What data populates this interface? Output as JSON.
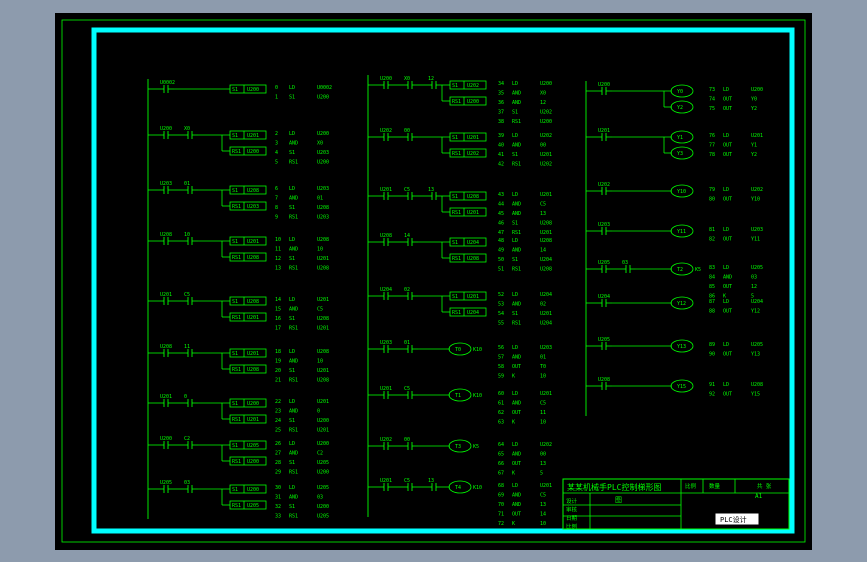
{
  "colors": {
    "line": "#00ff00",
    "frame": "#00ffff",
    "paper": "#000000",
    "background": "#8d9bad"
  },
  "column1": [
    {
      "contacts": [
        {
          "label": "U0002",
          "nc": false
        }
      ],
      "coils": [
        {
          "type": "box",
          "label": "U200",
          "set": "S1"
        }
      ],
      "instructions": [
        [
          "0",
          "LD",
          "U0002"
        ],
        [
          "1",
          "S1",
          "U200"
        ]
      ]
    },
    {
      "contacts": [
        {
          "label": "U200",
          "nc": false
        },
        {
          "label": "X0",
          "nc": false
        }
      ],
      "coils": [
        {
          "type": "box",
          "label": "U201",
          "set": "S1"
        },
        {
          "type": "box",
          "label": "U200",
          "set": "RS1"
        }
      ],
      "instructions": [
        [
          "2",
          "LD",
          "U200"
        ],
        [
          "3",
          "AND",
          "X0"
        ],
        [
          "4",
          "S1",
          "U203"
        ],
        [
          "5",
          "RS1",
          "U200"
        ]
      ]
    },
    {
      "contacts": [
        {
          "label": "U203",
          "nc": false
        },
        {
          "label": "01",
          "nc": false
        }
      ],
      "coils": [
        {
          "type": "box",
          "label": "U208",
          "set": "S1"
        },
        {
          "type": "box",
          "label": "U203",
          "set": "RS1"
        }
      ],
      "instructions": [
        [
          "6",
          "LD",
          "U203"
        ],
        [
          "7",
          "AND",
          "01"
        ],
        [
          "8",
          "S1",
          "U208"
        ],
        [
          "9",
          "RS1",
          "U203"
        ]
      ]
    },
    {
      "contacts": [
        {
          "label": "U208",
          "nc": false
        },
        {
          "label": "10",
          "nc": false
        }
      ],
      "coils": [
        {
          "type": "box",
          "label": "U201",
          "set": "S1"
        },
        {
          "type": "box",
          "label": "U208",
          "set": "RS1"
        }
      ],
      "instructions": [
        [
          "10",
          "LD",
          "U208"
        ],
        [
          "11",
          "AND",
          "10"
        ],
        [
          "12",
          "S1",
          "U201"
        ],
        [
          "13",
          "RS1",
          "U208"
        ]
      ]
    },
    {
      "contacts": [
        {
          "label": "U201",
          "nc": false
        },
        {
          "label": "C5",
          "nc": false
        }
      ],
      "coils": [
        {
          "type": "box",
          "label": "U208",
          "set": "S1"
        },
        {
          "type": "box",
          "label": "U201",
          "set": "RS1"
        }
      ],
      "instructions": [
        [
          "14",
          "LD",
          "U201"
        ],
        [
          "15",
          "AND",
          "C5"
        ],
        [
          "16",
          "S1",
          "U208"
        ],
        [
          "17",
          "RS1",
          "U201"
        ]
      ]
    },
    {
      "contacts": [
        {
          "label": "U208",
          "nc": false
        },
        {
          "label": "11",
          "nc": false
        }
      ],
      "coils": [
        {
          "type": "box",
          "label": "U201",
          "set": "S1"
        },
        {
          "type": "box",
          "label": "U208",
          "set": "RS1"
        }
      ],
      "instructions": [
        [
          "18",
          "LD",
          "U208"
        ],
        [
          "19",
          "AND",
          "10"
        ],
        [
          "20",
          "S1",
          "U201"
        ],
        [
          "21",
          "RS1",
          "U208"
        ]
      ]
    },
    {
      "contacts": [
        {
          "label": "U201",
          "nc": false
        },
        {
          "label": "0",
          "nc": false
        }
      ],
      "coils": [
        {
          "type": "box",
          "label": "U200",
          "set": "S1"
        },
        {
          "type": "box",
          "label": "U201",
          "set": "RS1"
        }
      ],
      "instructions": [
        [
          "22",
          "LD",
          "U201"
        ],
        [
          "23",
          "AND",
          "0"
        ],
        [
          "24",
          "S1",
          "U200"
        ],
        [
          "25",
          "RS1",
          "U201"
        ]
      ]
    },
    {
      "contacts": [
        {
          "label": "U200",
          "nc": false
        },
        {
          "label": "C2",
          "nc": false
        }
      ],
      "coils": [
        {
          "type": "box",
          "label": "U205",
          "set": "S1"
        },
        {
          "type": "box",
          "label": "U200",
          "set": "RS1"
        }
      ],
      "instructions": [
        [
          "26",
          "LD",
          "U200"
        ],
        [
          "27",
          "AND",
          "C2"
        ],
        [
          "28",
          "S1",
          "U205"
        ],
        [
          "29",
          "RS1",
          "U200"
        ]
      ]
    },
    {
      "contacts": [
        {
          "label": "U205",
          "nc": false
        },
        {
          "label": "03",
          "nc": false
        }
      ],
      "coils": [
        {
          "type": "box",
          "label": "U200",
          "set": "S1"
        },
        {
          "type": "box",
          "label": "U205",
          "set": "RS1"
        }
      ],
      "instructions": [
        [
          "30",
          "LD",
          "U205"
        ],
        [
          "31",
          "AND",
          "03"
        ],
        [
          "32",
          "S1",
          "U200"
        ],
        [
          "33",
          "RS1",
          "U205"
        ]
      ]
    }
  ],
  "column2": [
    {
      "contacts": [
        {
          "label": "U200",
          "nc": false
        },
        {
          "label": "X0",
          "nc": false
        },
        {
          "label": "12",
          "nc": false
        }
      ],
      "coils": [
        {
          "type": "box",
          "label": "U202",
          "set": "S1"
        },
        {
          "type": "box",
          "label": "U200",
          "set": "RS1"
        }
      ],
      "instructions": [
        [
          "34",
          "LD",
          "U200"
        ],
        [
          "35",
          "AND",
          "X0"
        ],
        [
          "36",
          "AND",
          "12"
        ],
        [
          "37",
          "S1",
          "U202"
        ],
        [
          "38",
          "RS1",
          "U200"
        ]
      ]
    },
    {
      "contacts": [
        {
          "label": "U202",
          "nc": false
        },
        {
          "label": "00",
          "nc": false
        }
      ],
      "coils": [
        {
          "type": "box",
          "label": "U201",
          "set": "S1"
        },
        {
          "type": "box",
          "label": "U202",
          "set": "RS1"
        }
      ],
      "instructions": [
        [
          "39",
          "LD",
          "U202"
        ],
        [
          "40",
          "AND",
          "00"
        ],
        [
          "41",
          "S1",
          "U201"
        ],
        [
          "42",
          "RS1",
          "U202"
        ]
      ]
    },
    {
      "contacts": [
        {
          "label": "U201",
          "nc": false
        },
        {
          "label": "C5",
          "nc": false
        },
        {
          "label": "13",
          "nc": false
        }
      ],
      "coils": [
        {
          "type": "box",
          "label": "U208",
          "set": "S1"
        },
        {
          "type": "box",
          "label": "U201",
          "set": "RS1"
        }
      ],
      "instructions": [
        [
          "43",
          "LD",
          "U201"
        ],
        [
          "44",
          "AND",
          "C5"
        ],
        [
          "45",
          "AND",
          "13"
        ],
        [
          "46",
          "S1",
          "U208"
        ],
        [
          "47",
          "RS1",
          "U201"
        ]
      ]
    },
    {
      "contacts": [
        {
          "label": "U208",
          "nc": false
        },
        {
          "label": "14",
          "nc": false
        }
      ],
      "coils": [
        {
          "type": "box",
          "label": "U204",
          "set": "S1"
        },
        {
          "type": "box",
          "label": "U208",
          "set": "RS1"
        }
      ],
      "instructions": [
        [
          "48",
          "LD",
          "U208"
        ],
        [
          "49",
          "AND",
          "14"
        ],
        [
          "50",
          "S1",
          "U204"
        ],
        [
          "51",
          "RS1",
          "U208"
        ]
      ]
    },
    {
      "contacts": [
        {
          "label": "U204",
          "nc": false
        },
        {
          "label": "02",
          "nc": false
        }
      ],
      "coils": [
        {
          "type": "box",
          "label": "U201",
          "set": "S1"
        },
        {
          "type": "box",
          "label": "U204",
          "set": "RS1"
        }
      ],
      "instructions": [
        [
          "52",
          "LD",
          "U204"
        ],
        [
          "53",
          "AND",
          "02"
        ],
        [
          "54",
          "S1",
          "U201"
        ],
        [
          "55",
          "RS1",
          "U204"
        ]
      ]
    },
    {
      "contacts": [
        {
          "label": "U203",
          "nc": false
        },
        {
          "label": "01",
          "nc": false
        }
      ],
      "coils": [
        {
          "type": "timer",
          "label": "T0",
          "param": "K10"
        }
      ],
      "instructions": [
        [
          "56",
          "LD",
          "U203"
        ],
        [
          "57",
          "AND",
          "01"
        ],
        [
          "58",
          "OUT",
          "T0"
        ],
        [
          "59",
          "K",
          "10"
        ]
      ]
    },
    {
      "contacts": [
        {
          "label": "U201",
          "nc": false
        },
        {
          "label": "C5",
          "nc": false
        }
      ],
      "coils": [
        {
          "type": "timer",
          "label": "T1",
          "param": "K10"
        }
      ],
      "instructions": [
        [
          "60",
          "LD",
          "U201"
        ],
        [
          "61",
          "AND",
          "C5"
        ],
        [
          "62",
          "OUT",
          "11"
        ],
        [
          "63",
          "K",
          "10"
        ]
      ]
    },
    {
      "contacts": [
        {
          "label": "U202",
          "nc": false
        },
        {
          "label": "00",
          "nc": false
        }
      ],
      "coils": [
        {
          "type": "timer",
          "label": "T3",
          "param": "K5"
        }
      ],
      "instructions": [
        [
          "64",
          "LD",
          "U202"
        ],
        [
          "65",
          "AND",
          "00"
        ],
        [
          "66",
          "OUT",
          "13"
        ],
        [
          "67",
          "K",
          "5"
        ]
      ]
    },
    {
      "contacts": [
        {
          "label": "U201",
          "nc": false
        },
        {
          "label": "C5",
          "nc": false
        },
        {
          "label": "13",
          "nc": false
        }
      ],
      "coils": [
        {
          "type": "timer",
          "label": "T4",
          "param": "K10"
        }
      ],
      "instructions": [
        [
          "68",
          "LD",
          "U201"
        ],
        [
          "69",
          "AND",
          "C5"
        ],
        [
          "70",
          "AND",
          "13"
        ],
        [
          "71",
          "OUT",
          "14"
        ],
        [
          "72",
          "K",
          "10"
        ]
      ]
    }
  ],
  "column3": [
    {
      "contacts": [
        {
          "label": "U200",
          "nc": false
        }
      ],
      "coils": [
        {
          "type": "out",
          "label": "Y0"
        },
        {
          "type": "out",
          "label": "Y2"
        }
      ],
      "instructions": [
        [
          "73",
          "LD",
          "U200"
        ],
        [
          "74",
          "OUT",
          "Y0"
        ],
        [
          "75",
          "OUT",
          "Y2"
        ]
      ]
    },
    {
      "contacts": [
        {
          "label": "U201",
          "nc": false
        }
      ],
      "coils": [
        {
          "type": "out",
          "label": "Y1"
        },
        {
          "type": "out",
          "label": "Y3"
        }
      ],
      "instructions": [
        [
          "76",
          "LD",
          "U201"
        ],
        [
          "77",
          "OUT",
          "Y1"
        ],
        [
          "78",
          "OUT",
          "Y2"
        ]
      ]
    },
    {
      "contacts": [
        {
          "label": "U202",
          "nc": false
        }
      ],
      "coils": [
        {
          "type": "out",
          "label": "Y10"
        }
      ],
      "instructions": [
        [
          "79",
          "LD",
          "U202"
        ],
        [
          "80",
          "OUT",
          "Y10"
        ]
      ]
    },
    {
      "contacts": [
        {
          "label": "U203",
          "nc": false
        }
      ],
      "coils": [
        {
          "type": "out",
          "label": "Y11"
        }
      ],
      "instructions": [
        [
          "81",
          "LD",
          "U203"
        ],
        [
          "82",
          "OUT",
          "Y11"
        ]
      ]
    },
    {
      "contacts": [
        {
          "label": "U205",
          "nc": false
        },
        {
          "label": "03",
          "nc": false
        }
      ],
      "coils": [
        {
          "type": "timer",
          "label": "T2",
          "param": "K5"
        }
      ],
      "instructions": [
        [
          "83",
          "LD",
          "U205"
        ],
        [
          "84",
          "AND",
          "03"
        ],
        [
          "85",
          "OUT",
          "12"
        ],
        [
          "86",
          "K",
          "5"
        ]
      ]
    },
    {
      "contacts": [
        {
          "label": "U204",
          "nc": false
        }
      ],
      "coils": [
        {
          "type": "out",
          "label": "Y12"
        }
      ],
      "instructions": [
        [
          "87",
          "LD",
          "U204"
        ],
        [
          "88",
          "OUT",
          "Y12"
        ]
      ]
    },
    {
      "contacts": [
        {
          "label": "U205",
          "nc": false
        }
      ],
      "coils": [
        {
          "type": "out",
          "label": "Y13"
        }
      ],
      "instructions": [
        [
          "89",
          "LD",
          "U205"
        ],
        [
          "90",
          "OUT",
          "Y13"
        ]
      ]
    },
    {
      "contacts": [
        {
          "label": "U208",
          "nc": false
        }
      ],
      "coils": [
        {
          "type": "out",
          "label": "Y15"
        }
      ],
      "instructions": [
        [
          "91",
          "LD",
          "U208"
        ],
        [
          "92",
          "OUT",
          "Y15"
        ]
      ]
    }
  ],
  "title_block": {
    "title": "某某机械手PLC控制梯形图",
    "drawing_label": "图",
    "rows": [
      "设计",
      "审核",
      "日期",
      "比例"
    ],
    "header_cells": [
      "比例",
      "数量",
      "",
      "共 张"
    ],
    "page": "A1",
    "stamp": "PLC设计"
  }
}
